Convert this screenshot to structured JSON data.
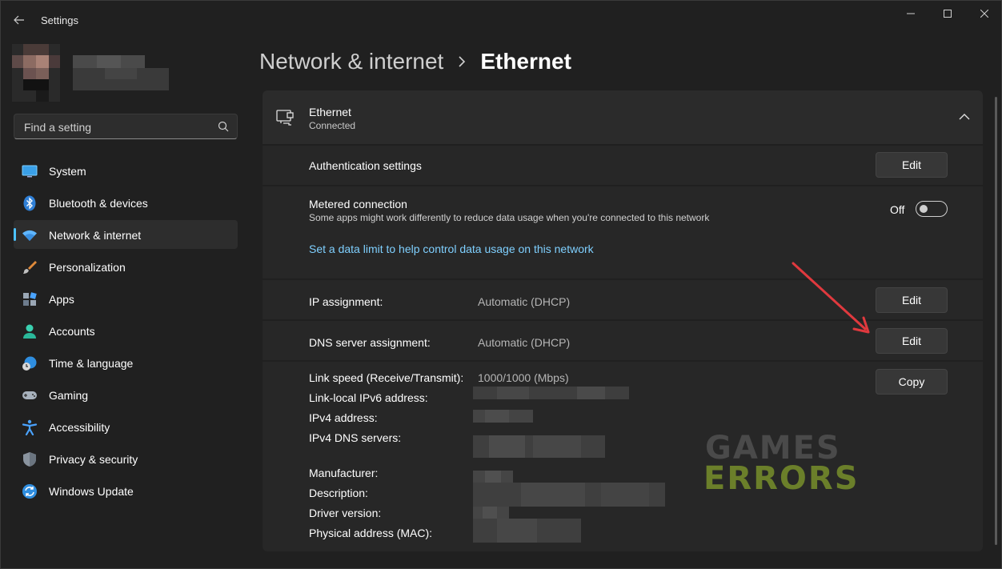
{
  "window": {
    "title": "Settings"
  },
  "search": {
    "placeholder": "Find a setting"
  },
  "nav": {
    "items": [
      {
        "label": "System",
        "icon": "monitor-icon"
      },
      {
        "label": "Bluetooth & devices",
        "icon": "bluetooth-icon"
      },
      {
        "label": "Network & internet",
        "icon": "wifi-icon",
        "active": true
      },
      {
        "label": "Personalization",
        "icon": "brush-icon"
      },
      {
        "label": "Apps",
        "icon": "apps-icon"
      },
      {
        "label": "Accounts",
        "icon": "person-icon"
      },
      {
        "label": "Time & language",
        "icon": "globe-clock-icon"
      },
      {
        "label": "Gaming",
        "icon": "gamepad-icon"
      },
      {
        "label": "Accessibility",
        "icon": "accessibility-icon"
      },
      {
        "label": "Privacy & security",
        "icon": "shield-icon"
      },
      {
        "label": "Windows Update",
        "icon": "update-icon"
      }
    ]
  },
  "breadcrumb": {
    "parent": "Network & internet",
    "current": "Ethernet"
  },
  "ethernet": {
    "title": "Ethernet",
    "status": "Connected"
  },
  "auth": {
    "label": "Authentication settings",
    "button": "Edit"
  },
  "metered": {
    "label": "Metered connection",
    "description": "Some apps might work differently to reduce data usage when you're connected to this network",
    "state": "Off",
    "link": "Set a data limit to help control data usage on this network"
  },
  "ip_assignment": {
    "label": "IP assignment:",
    "value": "Automatic (DHCP)",
    "button": "Edit"
  },
  "dns_assignment": {
    "label": "DNS server assignment:",
    "value": "Automatic (DHCP)",
    "button": "Edit"
  },
  "properties": {
    "button": "Copy",
    "link_speed_label": "Link speed (Receive/Transmit):",
    "link_speed_value": "1000/1000 (Mbps)",
    "ipv6_label": "Link-local IPv6 address:",
    "ipv4_label": "IPv4 address:",
    "dns_servers_label": "IPv4 DNS servers:",
    "manufacturer_label": "Manufacturer:",
    "description_label": "Description:",
    "driver_label": "Driver version:",
    "mac_label": "Physical address (MAC):"
  },
  "watermark": {
    "line1": "GAMES",
    "line2": "ERRORS"
  },
  "colors": {
    "accent": "#4cc2ff",
    "link": "#7fd0ff",
    "arrow": "#e0393e"
  }
}
